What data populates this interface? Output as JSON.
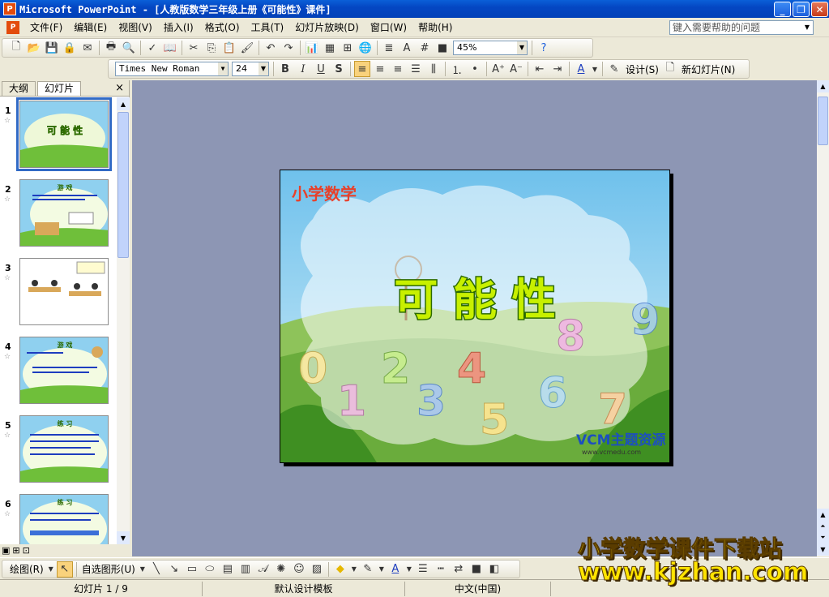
{
  "window": {
    "title": "Microsoft PowerPoint - [人教版数学三年级上册《可能性》课件]",
    "app_icon": "P",
    "min_icon": "minimize-icon",
    "max_icon": "restore-icon",
    "close_icon": "close-icon"
  },
  "menu": {
    "items": [
      "文件(F)",
      "编辑(E)",
      "视图(V)",
      "插入(I)",
      "格式(O)",
      "工具(T)",
      "幻灯片放映(D)",
      "窗口(W)",
      "帮助(H)"
    ],
    "help_placeholder": "键入需要帮助的问题"
  },
  "toolbar_standard": {
    "zoom": "45%"
  },
  "toolbar_format": {
    "font": "Times New Roman",
    "size": "24",
    "bold": "B",
    "italic": "I",
    "underline": "U",
    "shadow": "S",
    "design_label": "设计(S)",
    "new_slide_label": "新幻灯片(N)"
  },
  "left_pane": {
    "tabs": [
      "大纲",
      "幻灯片"
    ],
    "active_tab": "幻灯片",
    "close": "×",
    "slides": [
      {
        "num": "1",
        "title": "可 能 性"
      },
      {
        "num": "2",
        "title": "游 戏"
      },
      {
        "num": "3",
        "title": ""
      },
      {
        "num": "4",
        "title": "游 戏"
      },
      {
        "num": "5",
        "title": "练 习"
      },
      {
        "num": "6",
        "title": "练 习"
      }
    ]
  },
  "slide": {
    "brand": "小学数学",
    "title": "可 能 性",
    "logo": "VCM主题资源",
    "logo_url": "www.vcmedu.com",
    "numbers": [
      "0",
      "1",
      "2",
      "3",
      "4",
      "5",
      "6",
      "7",
      "8",
      "9"
    ]
  },
  "drawbar": {
    "draw_label": "绘图(R)",
    "autoshape_label": "自选图形(U)"
  },
  "status": {
    "slide_pos": "幻灯片 1 / 9",
    "template": "默认设计模板",
    "language": "中文(中国)"
  },
  "watermark": {
    "line1": "小学数学课件下载站",
    "line2": "www.kjzhan.com"
  },
  "colors": {
    "title_bar": "#0a5fd8",
    "workspace": "#8d96b4",
    "slide_title": "#c8f000",
    "brand": "#e8402a",
    "watermark": "#ffe400"
  }
}
